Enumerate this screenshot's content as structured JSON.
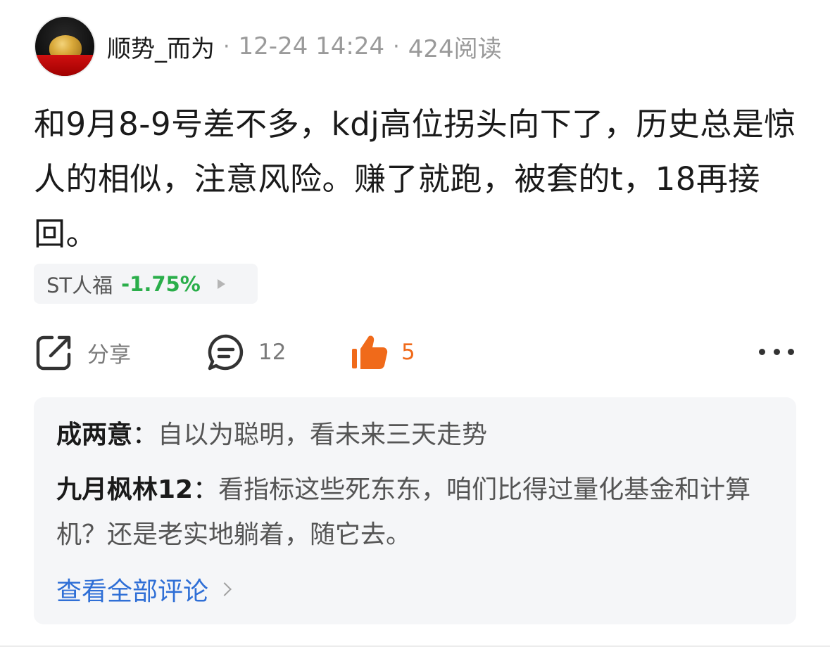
{
  "post": {
    "author": "顺势_而为",
    "time": "12-24 14:24",
    "reads": "424阅读",
    "separator": "·",
    "text": "和9月8-9号差不多，kdj高位拐头向下了，历史总是惊人的相似，注意风险。赚了就跑，被套的t，18再接回。"
  },
  "stock": {
    "name": "ST人福",
    "change": "-1.75%",
    "change_color": "#2aae4a"
  },
  "actions": {
    "share_label": "分享",
    "comment_count": "12",
    "like_count": "5",
    "like_color": "#f06a1a"
  },
  "comments": {
    "items": [
      {
        "user": "成两意",
        "colon": "：",
        "text": "自以为聪明，看未来三天走势"
      },
      {
        "user": "九月枫林12",
        "colon": "：",
        "text": "看指标这些死东东，咱们比得过量化基金和计算机？还是老实地躺着，随它去。"
      }
    ],
    "view_all": "查看全部评论",
    "link_color": "#2f6fd6"
  }
}
